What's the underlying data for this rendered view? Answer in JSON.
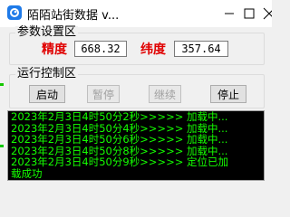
{
  "window": {
    "title": "陌陌站街数据 v...",
    "icon": "app-swirl-icon",
    "accent": "#1e7ae8"
  },
  "params_group": {
    "legend": "参数设置区",
    "lat_label": "精度",
    "lat_value": "668.32",
    "lon_label": "纬度",
    "lon_value": "357.64",
    "label_color": "#e00000"
  },
  "control_group": {
    "legend": "运行控制区",
    "buttons": [
      {
        "label": "启动",
        "enabled": true
      },
      {
        "label": "暂停",
        "enabled": false
      },
      {
        "label": "继续",
        "enabled": false
      },
      {
        "label": "停止",
        "enabled": true
      }
    ]
  },
  "log": {
    "text_color": "#14ff00",
    "lines": [
      "2023年2月3日4时50分2秒>>>>>  加载中...",
      "2023年2月3日4时50分4秒>>>>>  加载中...",
      "2023年2月3日4时50分6秒>>>>>  加载中...",
      "2023年2月3日4时50分8秒>>>>>  加载中...",
      "2023年2月3日4时50分9秒>>>>>  定位已加",
      "载成功"
    ]
  }
}
